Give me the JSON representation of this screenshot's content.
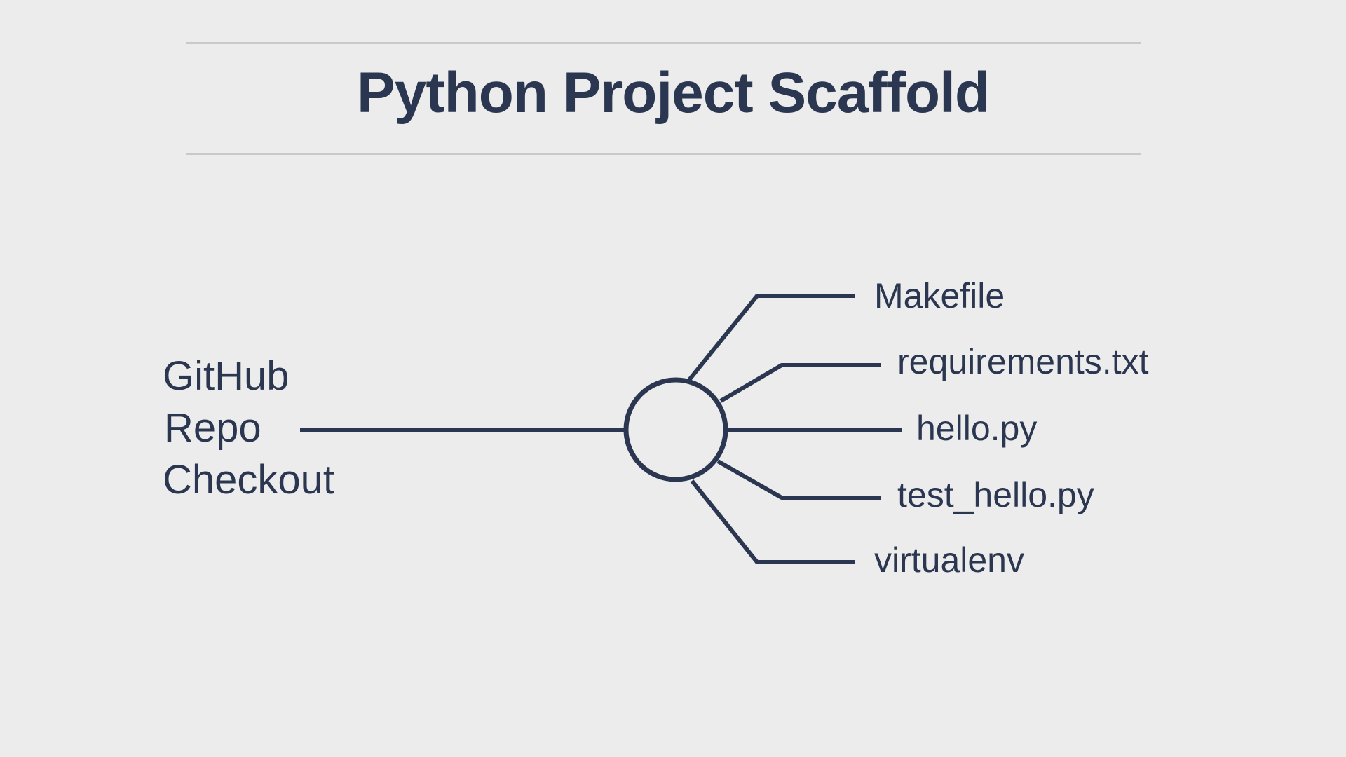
{
  "title": "Python Project Scaffold",
  "source": {
    "lines": [
      "GitHub",
      "Repo",
      "Checkout"
    ]
  },
  "leaves": [
    {
      "label": "Makefile"
    },
    {
      "label": "requirements.txt"
    },
    {
      "label": "hello.py"
    },
    {
      "label": "test_hello.py"
    },
    {
      "label": "virtualenv"
    }
  ],
  "colors": {
    "ink": "#2b3650",
    "background": "#ececec",
    "rule": "#c9c9c9"
  }
}
